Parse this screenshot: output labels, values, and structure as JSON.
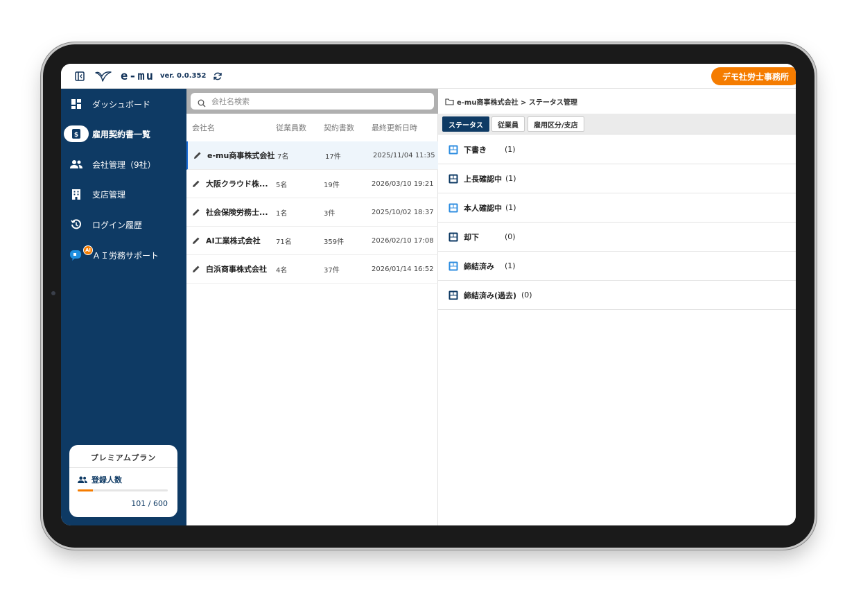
{
  "topbar": {
    "app_name": "e-mu",
    "version": "ver. 0.0.352",
    "office_badge": "デモ社労士事務所"
  },
  "sidebar": {
    "items": [
      {
        "label": "ダッシュボード",
        "icon": "dashboard-icon"
      },
      {
        "label": "雇用契約書一覧",
        "icon": "contract-icon"
      },
      {
        "label": "会社管理（9社）",
        "icon": "people-icon"
      },
      {
        "label": "支店管理",
        "icon": "building-icon"
      },
      {
        "label": "ログイン履歴",
        "icon": "history-icon"
      },
      {
        "label": "ＡＩ労務サポート",
        "icon": "chat-icon",
        "badge": "AI"
      }
    ],
    "plan": {
      "title": "プレミアムプラン",
      "users_label": "登録人数",
      "count_text": "101 / 600",
      "usage_fraction": 0.168
    }
  },
  "list": {
    "search_placeholder": "会社名検索",
    "headers": [
      "会社名",
      "従業員数",
      "契約書数",
      "最終更新日時"
    ],
    "rows": [
      {
        "name": "e-mu商事株式会社",
        "employees": "7名",
        "contracts": "17件",
        "updated": "2025/11/04 11:35"
      },
      {
        "name": "大阪クラウド株...",
        "employees": "5名",
        "contracts": "19件",
        "updated": "2026/03/10 19:21"
      },
      {
        "name": "社会保険労務士...",
        "employees": "1名",
        "contracts": "3件",
        "updated": "2025/10/02 18:37"
      },
      {
        "name": "AI工業株式会社",
        "employees": "71名",
        "contracts": "359件",
        "updated": "2026/02/10 17:08"
      },
      {
        "name": "白浜商事株式会社",
        "employees": "4名",
        "contracts": "37件",
        "updated": "2026/01/14 16:52"
      }
    ]
  },
  "detail": {
    "breadcrumb": "e-mu商事株式会社 > ステータス管理",
    "tabs": [
      "ステータス",
      "従業員",
      "雇用区分/支店"
    ],
    "statuses": [
      {
        "label": "下書き",
        "count": "(1)"
      },
      {
        "label": "上長確認中",
        "count": "(1)"
      },
      {
        "label": "本人確認中",
        "count": "(1)"
      },
      {
        "label": "却下",
        "count": "(0)"
      },
      {
        "label": "締結済み",
        "count": "(1)"
      },
      {
        "label": "締結済み(過去)",
        "count": "(0)"
      }
    ]
  },
  "colors": {
    "sidebar": "#0e3a64",
    "accent": "#f57c00",
    "selected_row": "#eef5fb",
    "status_icon_blue": "#2f8ee0",
    "status_icon_navy": "#0e3a64"
  }
}
